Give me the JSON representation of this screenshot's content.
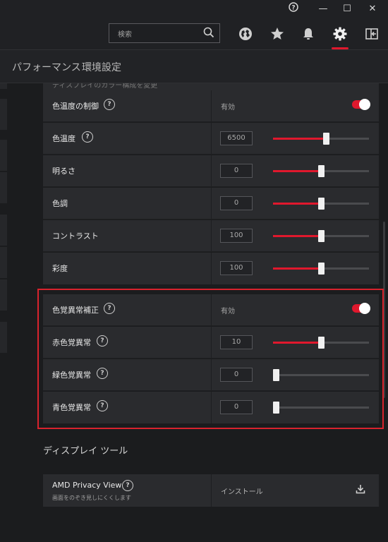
{
  "window": {
    "help_glyph": "?",
    "minimize_glyph": "—",
    "maximize_glyph": "☐",
    "close_glyph": "✕"
  },
  "toolbar": {
    "search_placeholder": "検索",
    "icons": [
      "search-icon",
      "globe-icon",
      "star-icon",
      "bell-icon",
      "gear-icon",
      "exit-icon"
    ]
  },
  "tabs": [
    {
      "label": "パフォーマンス"
    },
    {
      "label": "環境設定"
    }
  ],
  "display_settings": {
    "cut_off_label": "ディスプレイのカラー構成を変更",
    "color_temp_control": {
      "label": "色温度の制御",
      "status": "有効",
      "enabled": true
    },
    "color_temp": {
      "label": "色温度",
      "value": "6500",
      "min": 1000,
      "max": 11000
    },
    "brightness": {
      "label": "明るさ",
      "value": "0",
      "min": -100,
      "max": 100
    },
    "hue": {
      "label": "色調",
      "value": "0",
      "min": -100,
      "max": 100
    },
    "contrast": {
      "label": "コントラスト",
      "value": "100",
      "min": 0,
      "max": 200
    },
    "saturation": {
      "label": "彩度",
      "value": "100",
      "min": 0,
      "max": 200
    }
  },
  "color_blindness": {
    "correction": {
      "label": "色覚異常補正",
      "status": "有効",
      "enabled": true
    },
    "red": {
      "label": "赤色覚異常",
      "value": "10",
      "min": 0,
      "max": 20
    },
    "green": {
      "label": "緑色覚異常",
      "value": "0",
      "min": 0,
      "max": 20
    },
    "blue": {
      "label": "青色覚異常",
      "value": "0",
      "min": 0,
      "max": 20
    }
  },
  "display_tools": {
    "title": "ディスプレイ ツール",
    "privacy_view": {
      "label": "AMD Privacy View",
      "sub": "画面をのぞき見しにくくします",
      "action": "インストール"
    }
  },
  "colors": {
    "accent": "#e0182d",
    "highlight_box": "#d8232d"
  }
}
